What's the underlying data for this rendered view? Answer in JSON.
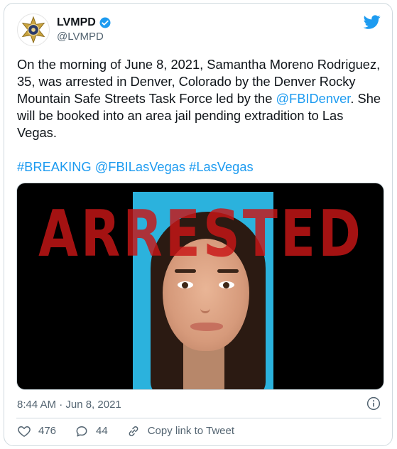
{
  "author": {
    "display_name": "LVMPD",
    "handle": "@LVMPD",
    "verified": true,
    "avatar_icon": "police-badge-icon"
  },
  "brand_icon": "twitter-bird-icon",
  "tweet": {
    "text_part1": "On the morning of June 8, 2021, Samantha Moreno Rodriguez, 35, was arrested in Denver, Colorado by the Denver Rocky Mountain Safe Streets Task Force led by the ",
    "mention1": "@FBIDenver",
    "text_part2": ". She will be booked into an area jail pending extradition to Las Vegas.",
    "hashtag1": "#BREAKING",
    "mention2": "@FBILasVegas",
    "hashtag2": "#LasVegas"
  },
  "media": {
    "stamp_text": "ARRESTED",
    "stamp_color": "#c81616",
    "background_color": "#2bb2dd"
  },
  "timestamp": "8:44 AM · Jun 8, 2021",
  "actions": {
    "like_count": "476",
    "reply_count": "44",
    "copy_link_label": "Copy link to Tweet"
  },
  "colors": {
    "link": "#1d9bf0",
    "text": "#0f1419",
    "secondary": "#536471"
  }
}
